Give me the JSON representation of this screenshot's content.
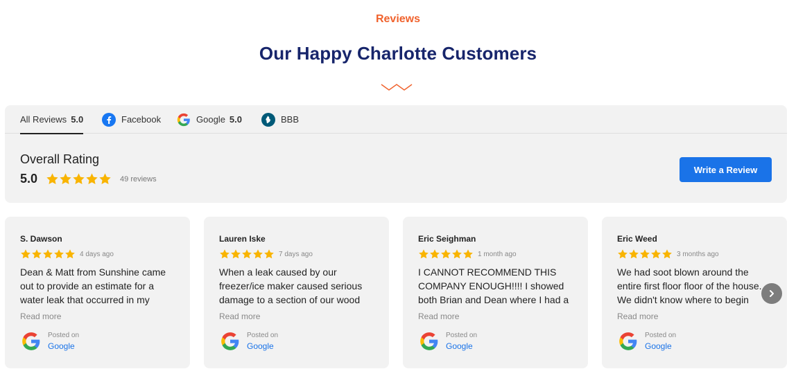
{
  "section": {
    "eyebrow": "Reviews",
    "title": "Our Happy Charlotte Customers"
  },
  "tabs": [
    {
      "label": "All Reviews",
      "score": "5.0",
      "icon": "none",
      "active": true
    },
    {
      "label": "Facebook",
      "score": "",
      "icon": "facebook-icon",
      "active": false
    },
    {
      "label": "Google",
      "score": "5.0",
      "icon": "google-icon",
      "active": false
    },
    {
      "label": "BBB",
      "score": "",
      "icon": "bbb-icon",
      "active": false
    }
  ],
  "overall": {
    "label": "Overall Rating",
    "score": "5.0",
    "stars": 5,
    "count": "49 reviews"
  },
  "write_review_label": "Write a Review",
  "reviews": [
    {
      "name": "S. Dawson",
      "stars": 5,
      "ago": "4 days ago",
      "text": "Dean & Matt from Sunshine came out to provide an estimate for a water leak that occurred in my",
      "read_more": "Read more",
      "posted_on": "Posted on",
      "source": "Google"
    },
    {
      "name": "Lauren Iske",
      "stars": 5,
      "ago": "7 days ago",
      "text": "When a leak caused by our freezer/ice maker caused serious damage to a section of our wood",
      "read_more": "Read more",
      "posted_on": "Posted on",
      "source": "Google"
    },
    {
      "name": "Eric Seighman",
      "stars": 5,
      "ago": "1 month ago",
      "text": "I CANNOT RECOMMEND THIS COMPANY ENOUGH!!!! I showed both Brian and Dean where I had a",
      "read_more": "Read more",
      "posted_on": "Posted on",
      "source": "Google"
    },
    {
      "name": "Eric Weed",
      "stars": 5,
      "ago": "3 months ago",
      "text": "We had soot blown around the entire first floor floor of the house. We didn't know where to begin",
      "read_more": "Read more",
      "posted_on": "Posted on",
      "source": "Google"
    }
  ],
  "colors": {
    "accent_orange": "#f0622d",
    "title_navy": "#17256b",
    "button_blue": "#1a73e8",
    "star_gold": "#f9b400"
  }
}
